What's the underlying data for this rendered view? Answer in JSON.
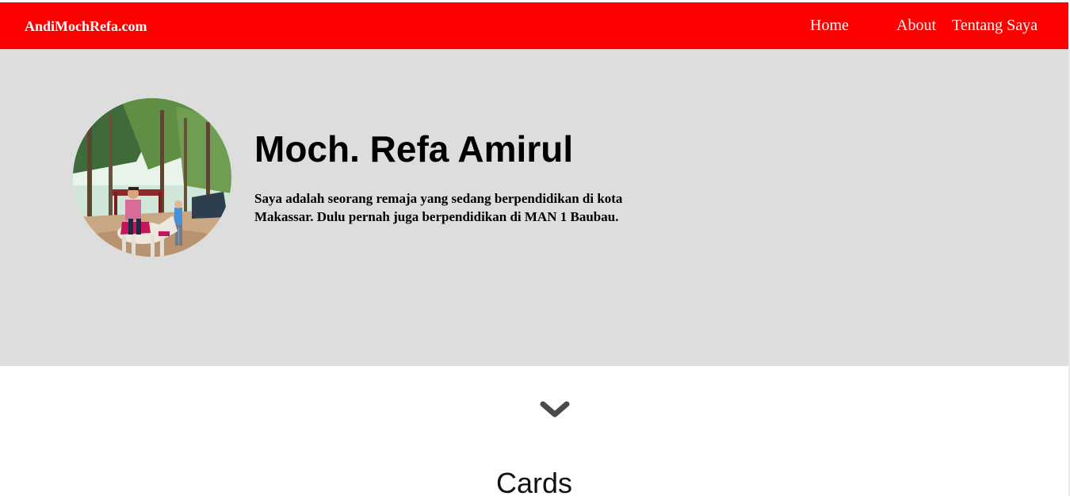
{
  "navbar": {
    "brand": "AndiMochRefa.com",
    "links": [
      {
        "label": "Home"
      },
      {
        "label": "About"
      },
      {
        "label": "Tentang Saya"
      }
    ],
    "color": "#ff0000"
  },
  "hero": {
    "background": "#dddddd",
    "photo_icon": "profile-photo-horse-riding",
    "name": "Moch. Refa Amirul",
    "description": "Saya adalah seorang remaja yang sedang berpendidikan di kota Makassar. Dulu pernah juga berpendidikan di MAN 1 Baubau."
  },
  "scroll": {
    "icon": "chevron-down-icon"
  },
  "section": {
    "title": "Cards"
  }
}
